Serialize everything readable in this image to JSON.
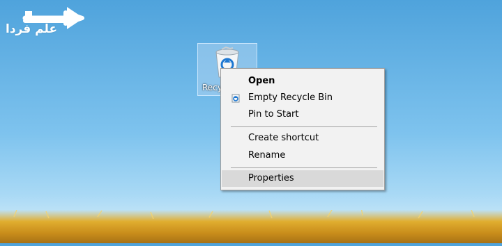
{
  "desktop": {
    "icon_label": "Recy"
  },
  "watermark": {
    "text": "علم فردا"
  },
  "context_menu": {
    "items": [
      {
        "label": "Open",
        "bold": true
      },
      {
        "label": "Empty Recycle Bin",
        "icon": "recycle-icon"
      },
      {
        "label": "Pin to Start"
      },
      {
        "label": "Create shortcut"
      },
      {
        "label": "Rename"
      },
      {
        "label": "Properties",
        "highlighted": true
      }
    ]
  }
}
